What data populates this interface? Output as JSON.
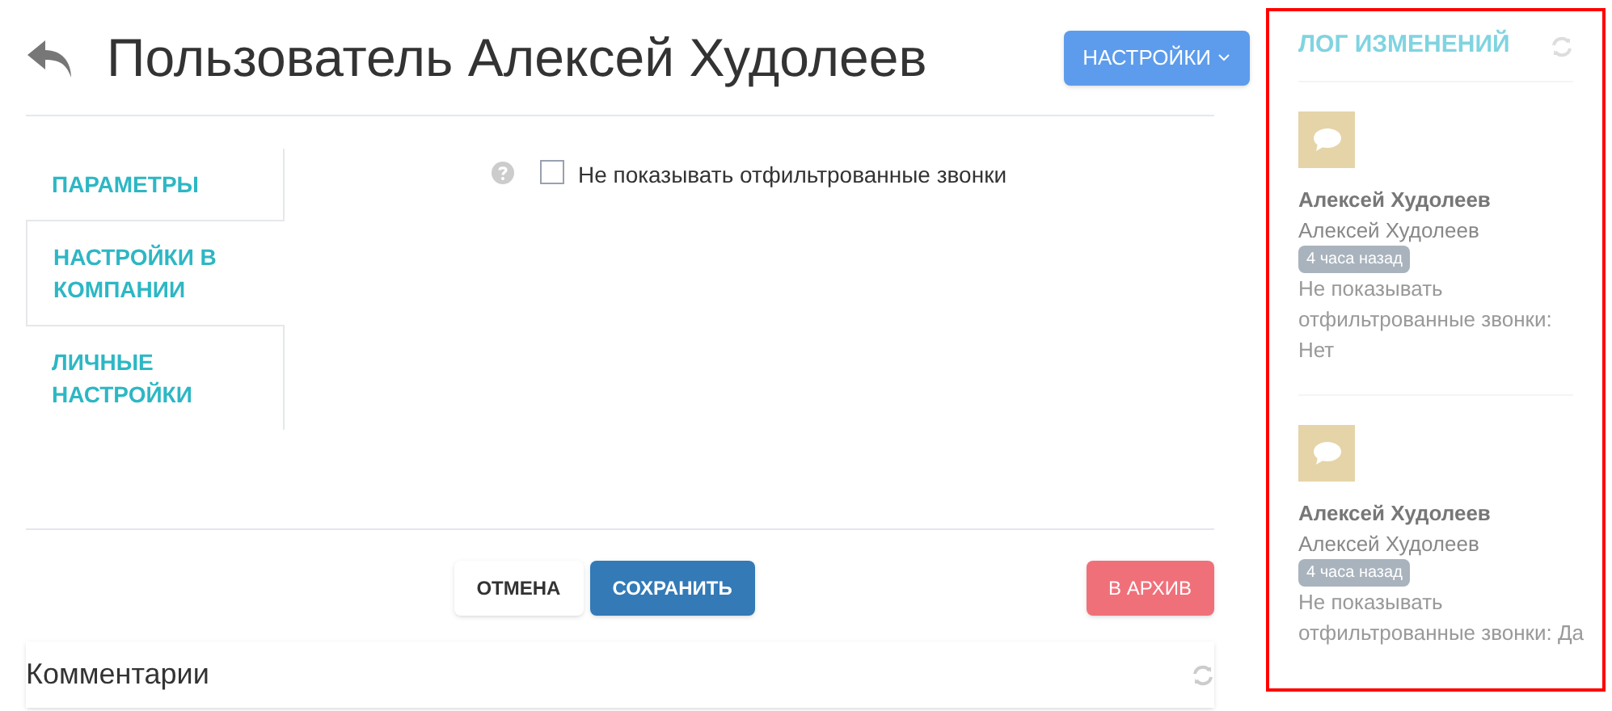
{
  "header": {
    "title": "Пользователь Алексей Худолеев",
    "settings_button": "НАСТРОЙКИ"
  },
  "tabs": [
    {
      "label": "ПАРАМЕТРЫ",
      "selected": false
    },
    {
      "label": "НАСТРОЙКИ В КОМПАНИИ",
      "selected": true
    },
    {
      "label": "ЛИЧНЫЕ НАСТРОЙКИ",
      "selected": false
    }
  ],
  "option": {
    "label": "Не показывать отфильтрованные звонки",
    "checked": false
  },
  "buttons": {
    "cancel": "ОТМЕНА",
    "save": "СОХРАНИТЬ",
    "archive": "В АРХИВ"
  },
  "comments": {
    "title": "Комментарии"
  },
  "changelog": {
    "title": "ЛОГ ИЗМЕНЕНИЙ",
    "entries": [
      {
        "author": "Алексей Худолеев",
        "user": "Алексей Худолеев",
        "time": "4 часа назад",
        "change": "Не показывать отфильтрованные звонки: Нет"
      },
      {
        "author": "Алексей Худолеев",
        "user": "Алексей Худолеев",
        "time": "4 часа назад",
        "change": "Не показывать отфильтрованные звонки: Да"
      }
    ]
  }
}
